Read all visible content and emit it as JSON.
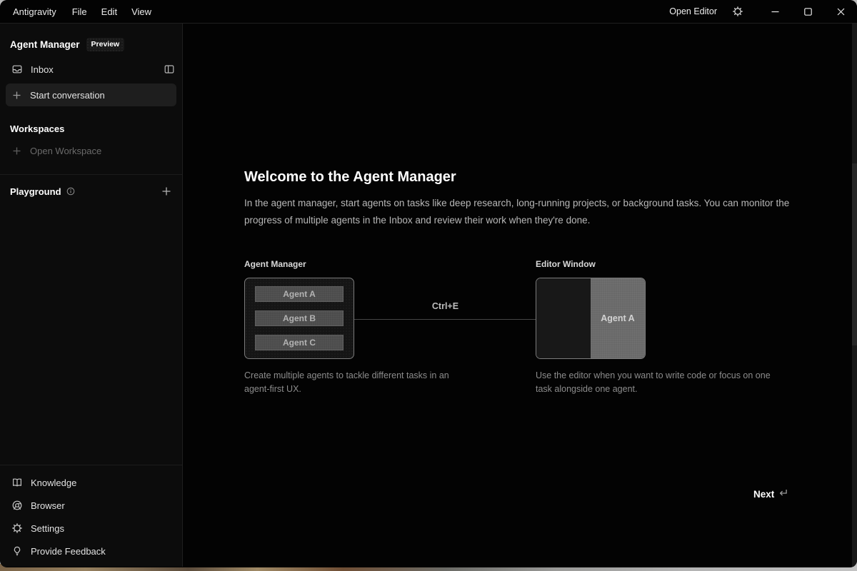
{
  "titlebar": {
    "app_menu": [
      "Antigravity",
      "File",
      "Edit",
      "View"
    ],
    "open_editor_label": "Open Editor"
  },
  "sidebar": {
    "header": {
      "title": "Agent Manager",
      "badge": "Preview"
    },
    "inbox_label": "Inbox",
    "start_conversation_label": "Start conversation",
    "workspaces_title": "Workspaces",
    "open_workspace_label": "Open Workspace",
    "playground_title": "Playground",
    "bottom_items": [
      {
        "label": "Knowledge"
      },
      {
        "label": "Browser"
      },
      {
        "label": "Settings"
      },
      {
        "label": "Provide Feedback"
      }
    ]
  },
  "main": {
    "heading": "Welcome to the Agent Manager",
    "description": "In the agent manager, start agents on tasks like deep research, long-running projects, or background tasks. You can monitor the progress of multiple agents in the Inbox and review their work when they're done.",
    "diagram": {
      "left": {
        "label": "Agent Manager",
        "agents": [
          "Agent A",
          "Agent B",
          "Agent C"
        ],
        "caption": "Create multiple agents to tackle different tasks in an agent-first UX."
      },
      "shortcut": "Ctrl+E",
      "right": {
        "label": "Editor Window",
        "agent": "Agent A",
        "caption": "Use the editor when you want to write code or focus on one task alongside one agent."
      }
    },
    "next_label": "Next"
  },
  "colors": {
    "window_background": "#030303",
    "sidebar_background": "#0c0c0c",
    "sidebar_highlight": "#1e1e1e",
    "divider": "#1f1f1f",
    "text_primary": "#ffffff",
    "text_secondary": "#b8b8b8",
    "text_dim": "#6a6a6a",
    "box_border": "#7c7c7c",
    "agent_bar": "#4c4c4c",
    "editor_agent_pane": "#696969"
  }
}
